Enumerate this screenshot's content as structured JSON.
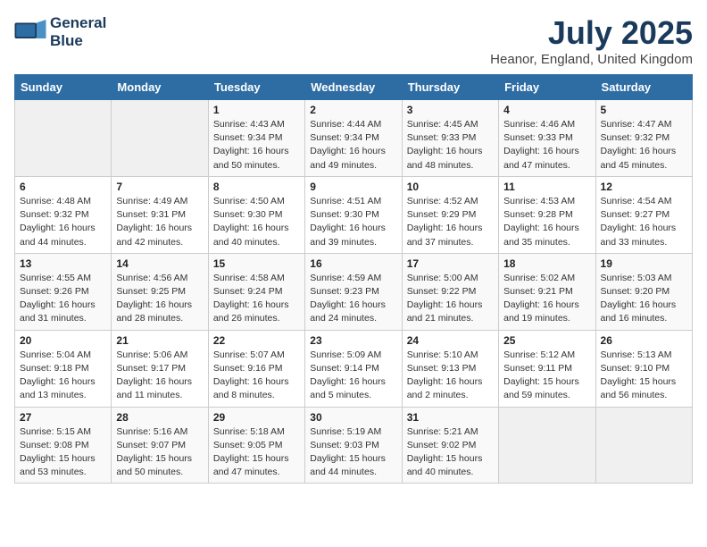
{
  "header": {
    "logo_line1": "General",
    "logo_line2": "Blue",
    "month_year": "July 2025",
    "location": "Heanor, England, United Kingdom"
  },
  "days_of_week": [
    "Sunday",
    "Monday",
    "Tuesday",
    "Wednesday",
    "Thursday",
    "Friday",
    "Saturday"
  ],
  "weeks": [
    [
      {
        "day": "",
        "info": ""
      },
      {
        "day": "",
        "info": ""
      },
      {
        "day": "1",
        "info": "Sunrise: 4:43 AM\nSunset: 9:34 PM\nDaylight: 16 hours and 50 minutes."
      },
      {
        "day": "2",
        "info": "Sunrise: 4:44 AM\nSunset: 9:34 PM\nDaylight: 16 hours and 49 minutes."
      },
      {
        "day": "3",
        "info": "Sunrise: 4:45 AM\nSunset: 9:33 PM\nDaylight: 16 hours and 48 minutes."
      },
      {
        "day": "4",
        "info": "Sunrise: 4:46 AM\nSunset: 9:33 PM\nDaylight: 16 hours and 47 minutes."
      },
      {
        "day": "5",
        "info": "Sunrise: 4:47 AM\nSunset: 9:32 PM\nDaylight: 16 hours and 45 minutes."
      }
    ],
    [
      {
        "day": "6",
        "info": "Sunrise: 4:48 AM\nSunset: 9:32 PM\nDaylight: 16 hours and 44 minutes."
      },
      {
        "day": "7",
        "info": "Sunrise: 4:49 AM\nSunset: 9:31 PM\nDaylight: 16 hours and 42 minutes."
      },
      {
        "day": "8",
        "info": "Sunrise: 4:50 AM\nSunset: 9:30 PM\nDaylight: 16 hours and 40 minutes."
      },
      {
        "day": "9",
        "info": "Sunrise: 4:51 AM\nSunset: 9:30 PM\nDaylight: 16 hours and 39 minutes."
      },
      {
        "day": "10",
        "info": "Sunrise: 4:52 AM\nSunset: 9:29 PM\nDaylight: 16 hours and 37 minutes."
      },
      {
        "day": "11",
        "info": "Sunrise: 4:53 AM\nSunset: 9:28 PM\nDaylight: 16 hours and 35 minutes."
      },
      {
        "day": "12",
        "info": "Sunrise: 4:54 AM\nSunset: 9:27 PM\nDaylight: 16 hours and 33 minutes."
      }
    ],
    [
      {
        "day": "13",
        "info": "Sunrise: 4:55 AM\nSunset: 9:26 PM\nDaylight: 16 hours and 31 minutes."
      },
      {
        "day": "14",
        "info": "Sunrise: 4:56 AM\nSunset: 9:25 PM\nDaylight: 16 hours and 28 minutes."
      },
      {
        "day": "15",
        "info": "Sunrise: 4:58 AM\nSunset: 9:24 PM\nDaylight: 16 hours and 26 minutes."
      },
      {
        "day": "16",
        "info": "Sunrise: 4:59 AM\nSunset: 9:23 PM\nDaylight: 16 hours and 24 minutes."
      },
      {
        "day": "17",
        "info": "Sunrise: 5:00 AM\nSunset: 9:22 PM\nDaylight: 16 hours and 21 minutes."
      },
      {
        "day": "18",
        "info": "Sunrise: 5:02 AM\nSunset: 9:21 PM\nDaylight: 16 hours and 19 minutes."
      },
      {
        "day": "19",
        "info": "Sunrise: 5:03 AM\nSunset: 9:20 PM\nDaylight: 16 hours and 16 minutes."
      }
    ],
    [
      {
        "day": "20",
        "info": "Sunrise: 5:04 AM\nSunset: 9:18 PM\nDaylight: 16 hours and 13 minutes."
      },
      {
        "day": "21",
        "info": "Sunrise: 5:06 AM\nSunset: 9:17 PM\nDaylight: 16 hours and 11 minutes."
      },
      {
        "day": "22",
        "info": "Sunrise: 5:07 AM\nSunset: 9:16 PM\nDaylight: 16 hours and 8 minutes."
      },
      {
        "day": "23",
        "info": "Sunrise: 5:09 AM\nSunset: 9:14 PM\nDaylight: 16 hours and 5 minutes."
      },
      {
        "day": "24",
        "info": "Sunrise: 5:10 AM\nSunset: 9:13 PM\nDaylight: 16 hours and 2 minutes."
      },
      {
        "day": "25",
        "info": "Sunrise: 5:12 AM\nSunset: 9:11 PM\nDaylight: 15 hours and 59 minutes."
      },
      {
        "day": "26",
        "info": "Sunrise: 5:13 AM\nSunset: 9:10 PM\nDaylight: 15 hours and 56 minutes."
      }
    ],
    [
      {
        "day": "27",
        "info": "Sunrise: 5:15 AM\nSunset: 9:08 PM\nDaylight: 15 hours and 53 minutes."
      },
      {
        "day": "28",
        "info": "Sunrise: 5:16 AM\nSunset: 9:07 PM\nDaylight: 15 hours and 50 minutes."
      },
      {
        "day": "29",
        "info": "Sunrise: 5:18 AM\nSunset: 9:05 PM\nDaylight: 15 hours and 47 minutes."
      },
      {
        "day": "30",
        "info": "Sunrise: 5:19 AM\nSunset: 9:03 PM\nDaylight: 15 hours and 44 minutes."
      },
      {
        "day": "31",
        "info": "Sunrise: 5:21 AM\nSunset: 9:02 PM\nDaylight: 15 hours and 40 minutes."
      },
      {
        "day": "",
        "info": ""
      },
      {
        "day": "",
        "info": ""
      }
    ]
  ]
}
